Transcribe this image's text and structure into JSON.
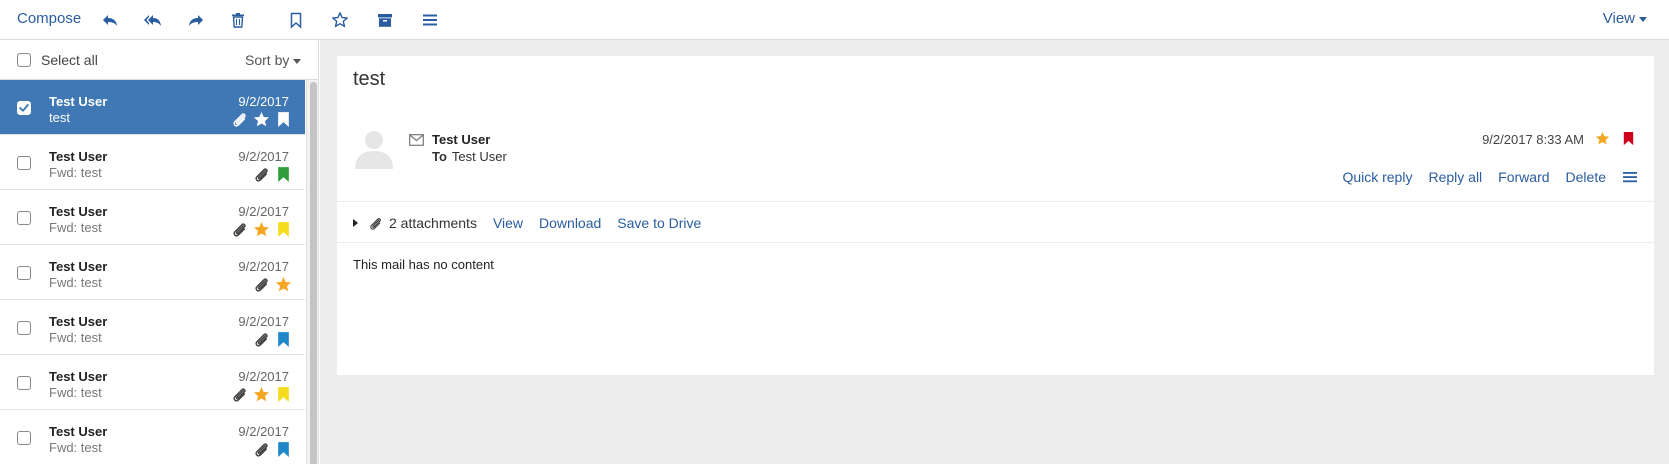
{
  "toolbar": {
    "compose_label": "Compose",
    "view_label": "View",
    "icons": [
      "reply-icon",
      "reply-all-icon",
      "forward-icon",
      "trash-icon",
      "bookmark-icon",
      "star-icon",
      "archive-icon",
      "menu-icon"
    ]
  },
  "list": {
    "select_all_label": "Select all",
    "sort_label": "Sort by",
    "rows": [
      {
        "sender": "Test User",
        "subject": "test",
        "date": "9/2/2017",
        "selected": true,
        "attachment": true,
        "star": true,
        "flag": "#ffffff"
      },
      {
        "sender": "Test User",
        "subject": "Fwd: test",
        "date": "9/2/2017",
        "selected": false,
        "attachment": true,
        "star": false,
        "flag": "#2e9e3d"
      },
      {
        "sender": "Test User",
        "subject": "Fwd: test",
        "date": "9/2/2017",
        "selected": false,
        "attachment": true,
        "star": true,
        "flag": "#f5dc1f"
      },
      {
        "sender": "Test User",
        "subject": "Fwd: test",
        "date": "9/2/2017",
        "selected": false,
        "attachment": true,
        "star": true,
        "flag": ""
      },
      {
        "sender": "Test User",
        "subject": "Fwd: test",
        "date": "9/2/2017",
        "selected": false,
        "attachment": true,
        "star": false,
        "flag": "#1e88c8"
      },
      {
        "sender": "Test User",
        "subject": "Fwd: test",
        "date": "9/2/2017",
        "selected": false,
        "attachment": true,
        "star": true,
        "flag": "#f5dc1f"
      },
      {
        "sender": "Test User",
        "subject": "Fwd: test",
        "date": "9/2/2017",
        "selected": false,
        "attachment": true,
        "star": false,
        "flag": "#1e88c8"
      }
    ]
  },
  "message": {
    "subject": "test",
    "from": "Test User",
    "to_label": "To",
    "to": "Test User",
    "date": "9/2/2017 8:33 AM",
    "starred": true,
    "flag_color": "#d0021b",
    "actions": {
      "quick_reply": "Quick reply",
      "reply_all": "Reply all",
      "forward": "Forward",
      "delete": "Delete"
    },
    "attachments": {
      "count_label": "2 attachments",
      "view": "View",
      "download": "Download",
      "save_to_drive": "Save to Drive"
    },
    "body": "This mail has no content"
  },
  "colors": {
    "accent": "#2a5d9f",
    "selected_row": "#3f78b5",
    "star": "#f5a623"
  }
}
